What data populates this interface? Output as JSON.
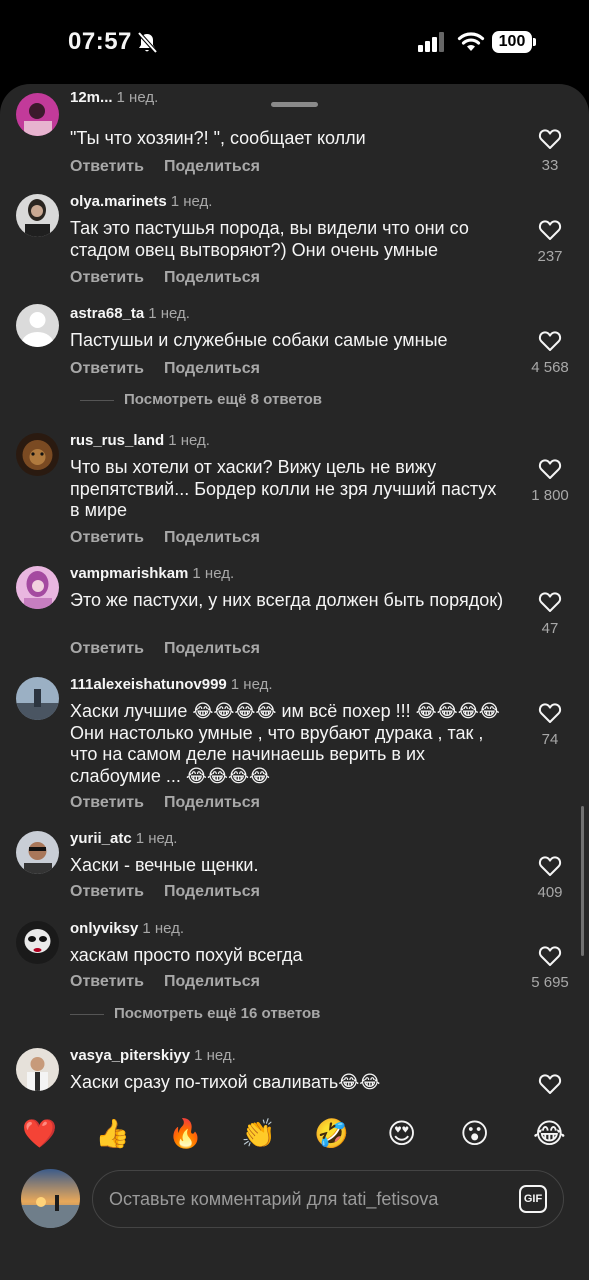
{
  "status": {
    "time": "07:57",
    "battery": "100"
  },
  "comments": [
    {
      "username": "12m...",
      "time": "1 нед.",
      "text": "\"Ты что хозяин?! \", сообщает колли",
      "likes": "33"
    },
    {
      "username": "olya.marinets",
      "time": "1 нед.",
      "text": "Так это пастушья порода, вы видели что они со стадом овец вытворяют?) Они очень умные",
      "likes": "237"
    },
    {
      "username": "astra68_ta",
      "time": "1 нед.",
      "text": "Пастушьи и служебные собаки самые умные",
      "likes": "4 568",
      "more_replies": "Посмотреть ещё 8 ответов"
    },
    {
      "username": "rus_rus_land",
      "time": "1 нед.",
      "text": "Что вы хотели от хаски? Вижу цель не вижу препятствий... Бордер колли не зря лучший пастух в мире",
      "likes": "1 800"
    },
    {
      "username": "vampmarishkam",
      "time": "1 нед.",
      "text": "Это же пастухи, у них всегда должен быть порядок)",
      "likes": "47"
    },
    {
      "username": "111alexeishatunov999",
      "time": "1 нед.",
      "text": "Хаски лучшие 😂😂😂😂 им всё похер !!! 😂😂😂😂 Они настолько умные , что врубают дурака , так , что на самом деле начинаешь верить в их слабоумие ... 😂😂😂😂",
      "likes": "74"
    },
    {
      "username": "yurii_atc",
      "time": "1 нед.",
      "text": "Хаски - вечные щенки.",
      "likes": "409"
    },
    {
      "username": "onlyviksy",
      "time": "1 нед.",
      "text": "хаскам просто похуй всегда",
      "likes": "5 695",
      "more_replies": "Посмотреть ещё 16 ответов"
    },
    {
      "username": "vasya_piterskiyy",
      "time": "1 нед.",
      "text": "Хаски сразу по-тихой сваливать😂😂",
      "likes": ""
    }
  ],
  "actions": {
    "reply": "Ответить",
    "share": "Поделиться"
  },
  "quick_emojis": [
    "❤️",
    "👍",
    "🔥",
    "👏",
    "🤣",
    "😍",
    "😮",
    "😂"
  ],
  "composer": {
    "placeholder": "Оставьте комментарий для tati_fetisova",
    "gif_label": "GIF"
  }
}
